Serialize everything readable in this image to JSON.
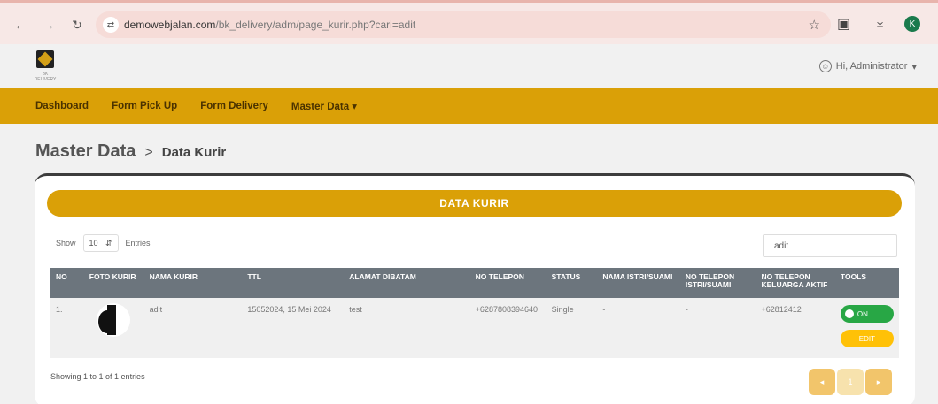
{
  "browser": {
    "url_host": "demowebjalan.com",
    "url_path": "/bk_delivery/adm/page_kurir.php?cari=adit",
    "profile_initial": "K",
    "icons": [
      "back-icon",
      "forward-icon",
      "reload-icon",
      "site-settings-icon",
      "star-icon",
      "extensions-icon",
      "download-icon"
    ]
  },
  "header": {
    "logo_small_text": "BK DELIVERY",
    "user_label": "Hi, Administrator",
    "user_caret": "▾"
  },
  "nav": {
    "items": [
      "Dashboard",
      "Form Pick Up",
      "Form Delivery",
      "Master Data ▾"
    ]
  },
  "breadcrumb": {
    "main": "Master Data",
    "sep": ">",
    "sub": "Data Kurir"
  },
  "card": {
    "title": "DATA KURIR",
    "show_label": "Show",
    "show_value": "10",
    "entries_label": "Entries",
    "search_value": "adit",
    "columns": [
      "NO",
      "FOTO KURIR",
      "NAMA KURIR",
      "TTL",
      "ALAMAT DIBATAM",
      "NO TELEPON",
      "STATUS",
      "NAMA ISTRI/SUAMI",
      "NO TELEPON ISTRI/SUAMI",
      "NO TELEPON KELUARGA AKTIF",
      "TOOLS"
    ],
    "rows": [
      {
        "no": "1.",
        "nama": "adit",
        "ttl": "15052024, 15 Mei 2024",
        "alamat": "test",
        "telepon": "+6287808394640",
        "status": "Single",
        "nama_pasangan": "-",
        "telepon_pasangan": "-",
        "telepon_keluarga": "+62812412",
        "toggle_label": "ON",
        "edit_label": "EDIT"
      }
    ],
    "showing_text": "Showing 1 to 1 of 1 entries",
    "pager": {
      "prev": "◂",
      "page": "1",
      "next": "▸"
    }
  },
  "colors": {
    "primary": "#daa007",
    "table_header": "#6c757d",
    "toggle_on": "#28a745",
    "edit": "#ffc107"
  }
}
